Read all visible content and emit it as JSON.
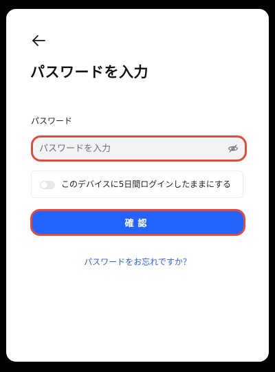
{
  "header": {
    "back_icon": "arrow-left-icon",
    "title": "パスワードを入力"
  },
  "password_field": {
    "label": "パスワード",
    "placeholder": "パスワードを入力",
    "value": "",
    "visibility_icon": "eye-off-icon"
  },
  "remember": {
    "label": "このデバイスに5日間ログインしたままにする",
    "checked": false
  },
  "actions": {
    "submit_label": "確認",
    "forgot_password_label": "パスワードをお忘れですか？"
  },
  "colors": {
    "primary": "#2563ff",
    "highlight_border": "#e24c3a",
    "link": "#2b62e6",
    "input_bg": "#f2f3f5"
  }
}
